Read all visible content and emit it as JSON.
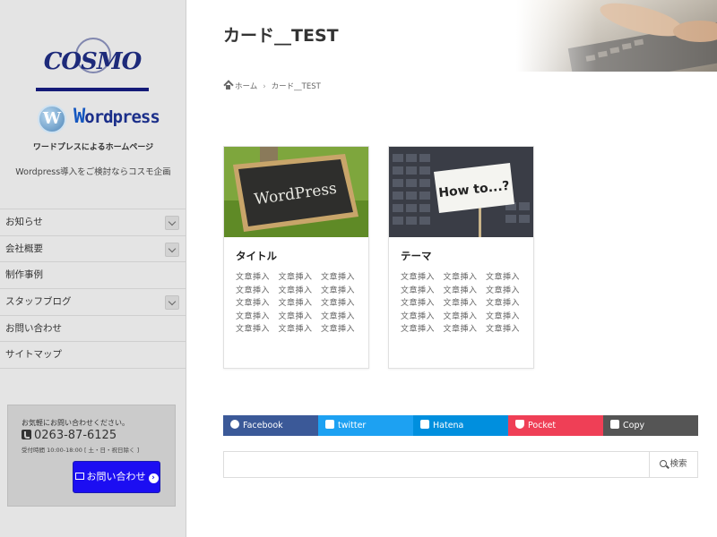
{
  "sidebar": {
    "logo_text": "COSMO",
    "wp_logo_text": "ordpress",
    "wp_logo_initial": "W",
    "tagline": "ワードプレスによるホームページ",
    "description": "Wordpress導入をご検討ならコスモ企画",
    "menu": [
      {
        "label": "お知らせ",
        "has_submenu": true
      },
      {
        "label": "会社概要",
        "has_submenu": true
      },
      {
        "label": "制作事例",
        "has_submenu": false
      },
      {
        "label": "スタッフブログ",
        "has_submenu": true
      },
      {
        "label": "お問い合わせ",
        "has_submenu": false
      },
      {
        "label": "サイトマップ",
        "has_submenu": false
      }
    ],
    "contact": {
      "lead": "お気軽にお問い合わせください。",
      "phone": "0263-87-6125",
      "hours": "受付時間 10:00-18:00 [ 土・日・祝日除く ]",
      "button_label": "お問い合わせ"
    }
  },
  "main": {
    "page_title": "カード__TEST",
    "breadcrumb": {
      "home": "ホーム",
      "current": "カード__TEST"
    },
    "cards": [
      {
        "title": "タイトル",
        "body": "文章挿入　文章挿入　文章挿入　文章挿入　文章挿入　文章挿入　文章挿入　文章挿入　文章挿入　文章挿入　文章挿入　文章挿入　文章挿入　文章挿入　文章挿入",
        "image_text": "WordPress"
      },
      {
        "title": "テーマ",
        "body": "文章挿入　文章挿入　文章挿入　文章挿入　文章挿入　文章挿入　文章挿入　文章挿入　文章挿入　文章挿入　文章挿入　文章挿入　文章挿入　文章挿入　文章挿入",
        "image_text": "How to...?"
      }
    ],
    "share": [
      {
        "label": "Facebook",
        "color": "#3b5998",
        "icon": "facebook-icon"
      },
      {
        "label": "twitter",
        "color": "#1da1f2",
        "icon": "twitter-icon"
      },
      {
        "label": "Hatena",
        "color": "#008fde",
        "icon": "hatena-icon"
      },
      {
        "label": "Pocket",
        "color": "#ef3f56",
        "icon": "pocket-icon"
      },
      {
        "label": "Copy",
        "color": "#555555",
        "icon": "copy-icon"
      }
    ],
    "search": {
      "placeholder": "",
      "button_label": "検索"
    }
  }
}
